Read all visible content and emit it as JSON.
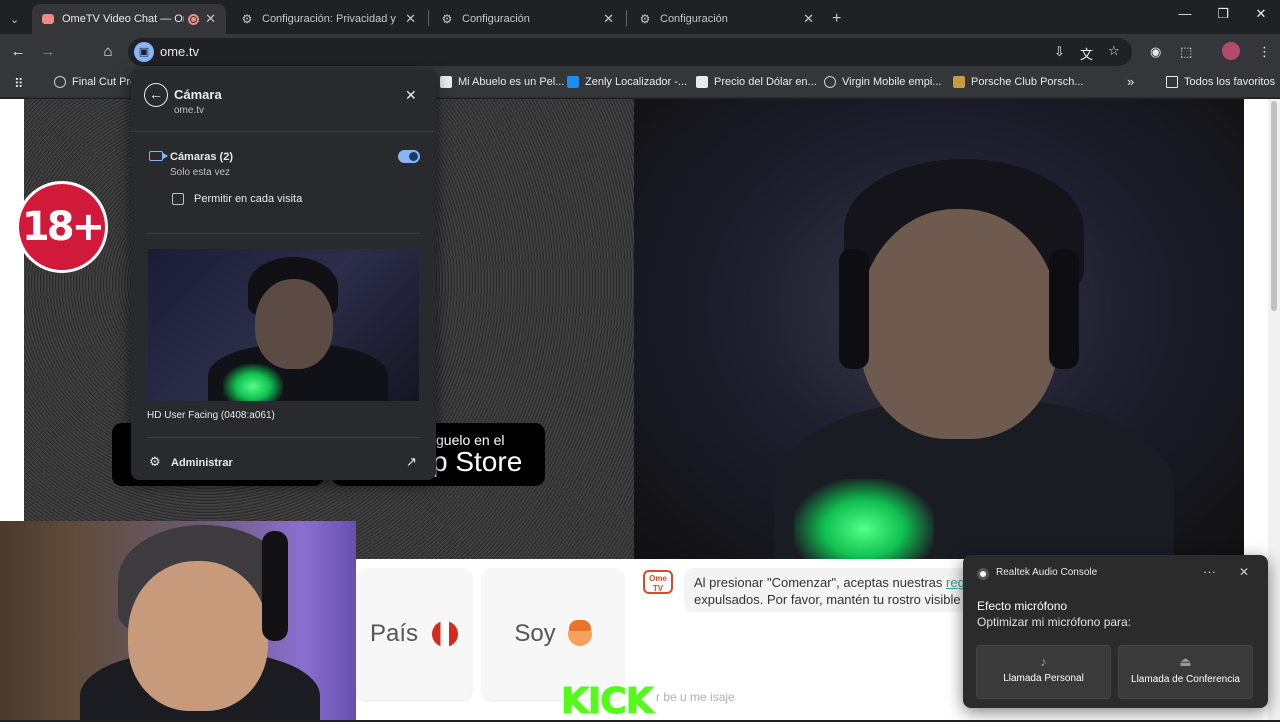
{
  "browser": {
    "tabs": [
      {
        "title": "OmeTV Video Chat — Ome",
        "icon": "omtv-favicon",
        "active": true,
        "recording": true
      },
      {
        "title": "Configuración: Privacidad y seg",
        "icon": "gear-icon",
        "active": false
      },
      {
        "title": "Configuración",
        "icon": "gear-icon",
        "active": false
      },
      {
        "title": "Configuración",
        "icon": "gear-icon",
        "active": false
      }
    ],
    "new_tab_symbol": "+",
    "url": "ome.tv",
    "bookmarks": [
      {
        "label": "Final Cut Pro",
        "icon": "globe-icon"
      },
      {
        "label": "Mi Abuelo es un Pel...",
        "icon": "film-icon"
      },
      {
        "label": "Zenly Localizador -...",
        "icon": "appstore-icon"
      },
      {
        "label": "Precio del Dólar en...",
        "icon": "news-icon"
      },
      {
        "label": "Virgin Mobile empi...",
        "icon": "globe-icon"
      },
      {
        "label": "Porsche Club Porsch...",
        "icon": "porsche-icon"
      }
    ],
    "bookmarks_overflow": "»",
    "all_bookmarks": "Todos los favoritos"
  },
  "permission_popup": {
    "title": "Cámara",
    "site": "ome.tv",
    "cameras_label": "Cámaras (2)",
    "cameras_sub": "Solo esta vez",
    "toggle_on": true,
    "checkbox_label": "Permitir en cada visita",
    "checkbox_checked": false,
    "camera_name": "HD User Facing (0408:a061)",
    "manage_label": "Administrar"
  },
  "page": {
    "age_badge": "18+",
    "store_line1": "guelo en el",
    "store_line2": "p Store",
    "filter_country": "País",
    "filter_gender": "Soy",
    "notice_line1_prefix": "Al presionar \"Comenzar\", aceptas nuestras ",
    "notice_link": "regla",
    "notice_line2": "expulsados. Por favor, mantén tu rostro visible e",
    "ome_logo": "Ome TV",
    "kick_text": "KICK",
    "chat_placeholder": "r be u me isaje"
  },
  "toast": {
    "app": "Realtek Audio Console",
    "more": "···",
    "title": "Efecto micrófono",
    "subtitle": "Optimizar mi micrófono para:",
    "buttons": [
      {
        "label": "Llamada Personal",
        "icon": "microphone-icon"
      },
      {
        "label": "Llamada de Conferencia",
        "icon": "conference-mic-icon"
      }
    ]
  },
  "colors": {
    "accent": "#8ab4f8",
    "age_badge": "#d11a3a",
    "kick_green": "#53fc18",
    "tab_recording": "#f28b82"
  }
}
